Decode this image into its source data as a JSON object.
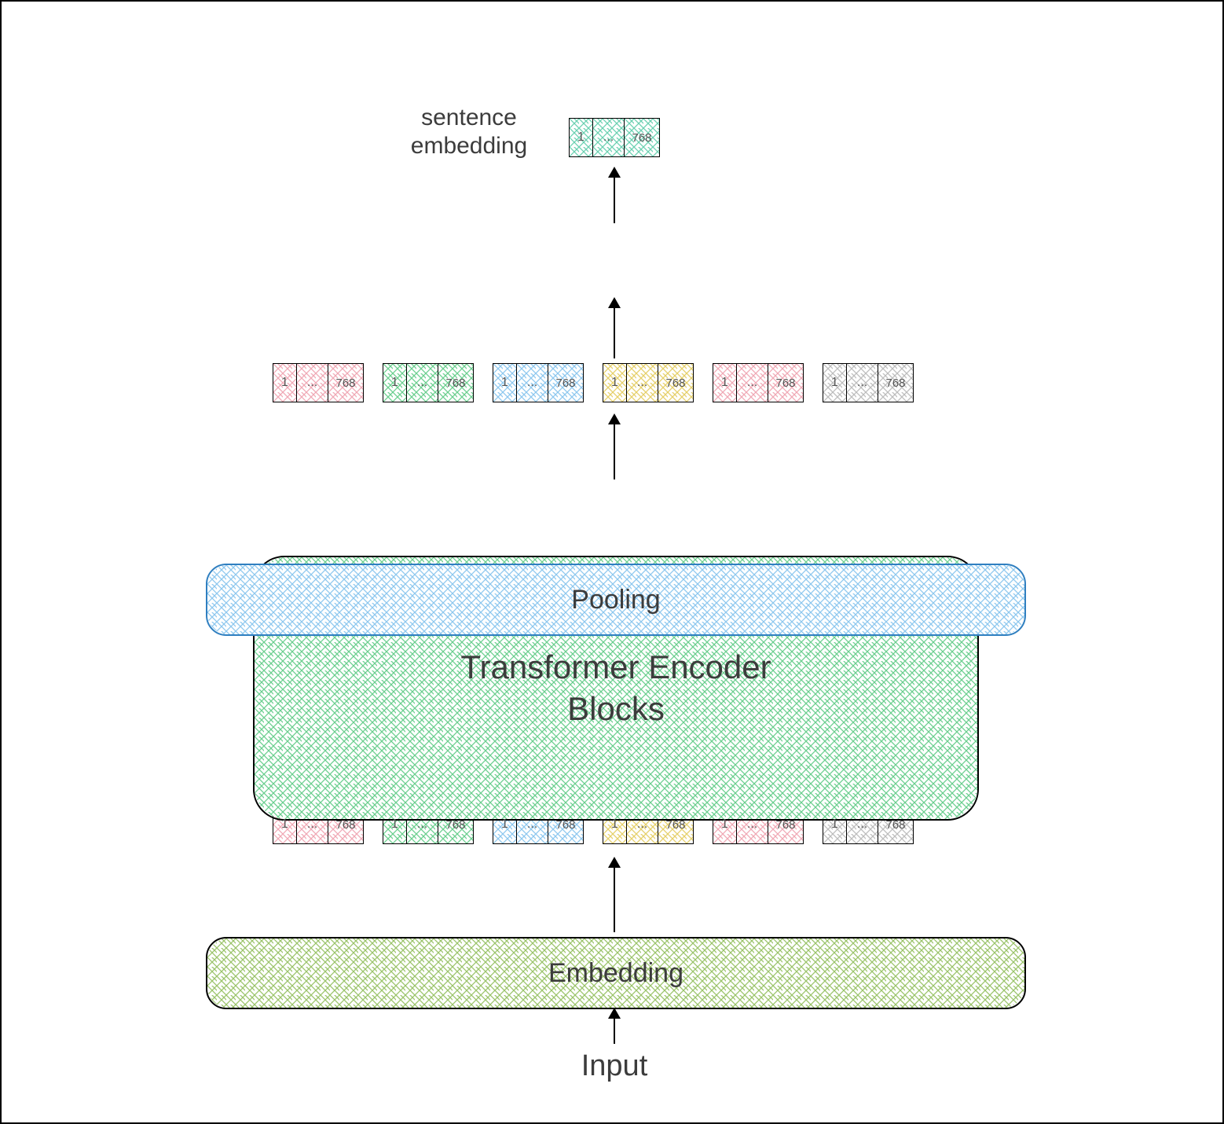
{
  "labels": {
    "input": "Input",
    "embedding": "Embedding",
    "encoder_line1": "Transformer Encoder",
    "encoder_line2": "Blocks",
    "pooling": "Pooling",
    "sentence_line1": "sentence",
    "sentence_line2": "embedding"
  },
  "token_cells": {
    "first": "1",
    "mid": "...",
    "last": "768"
  },
  "token_row_colors": [
    "pink",
    "green",
    "blue",
    "yellow",
    "pink",
    "gray"
  ],
  "output_token_color": "teal",
  "colors": {
    "pink": "#f0a9b6",
    "green": "#6bcf8f",
    "blue": "#8ec8ef",
    "yellow": "#e6d06a",
    "gray": "#bdbdbd",
    "teal": "#6bd1b1",
    "olive": "#9bc46b",
    "pooling_border": "#2f7fc0",
    "text": "#3c3c3c"
  },
  "chart_data": {
    "type": "diagram",
    "flow": [
      "Input",
      "Embedding",
      "token_embeddings[6]",
      "Transformer Encoder Blocks",
      "token_embeddings[6]",
      "Pooling",
      "sentence_embedding[1]"
    ],
    "embedding_dim": 768,
    "num_tokens_shown": 6
  }
}
